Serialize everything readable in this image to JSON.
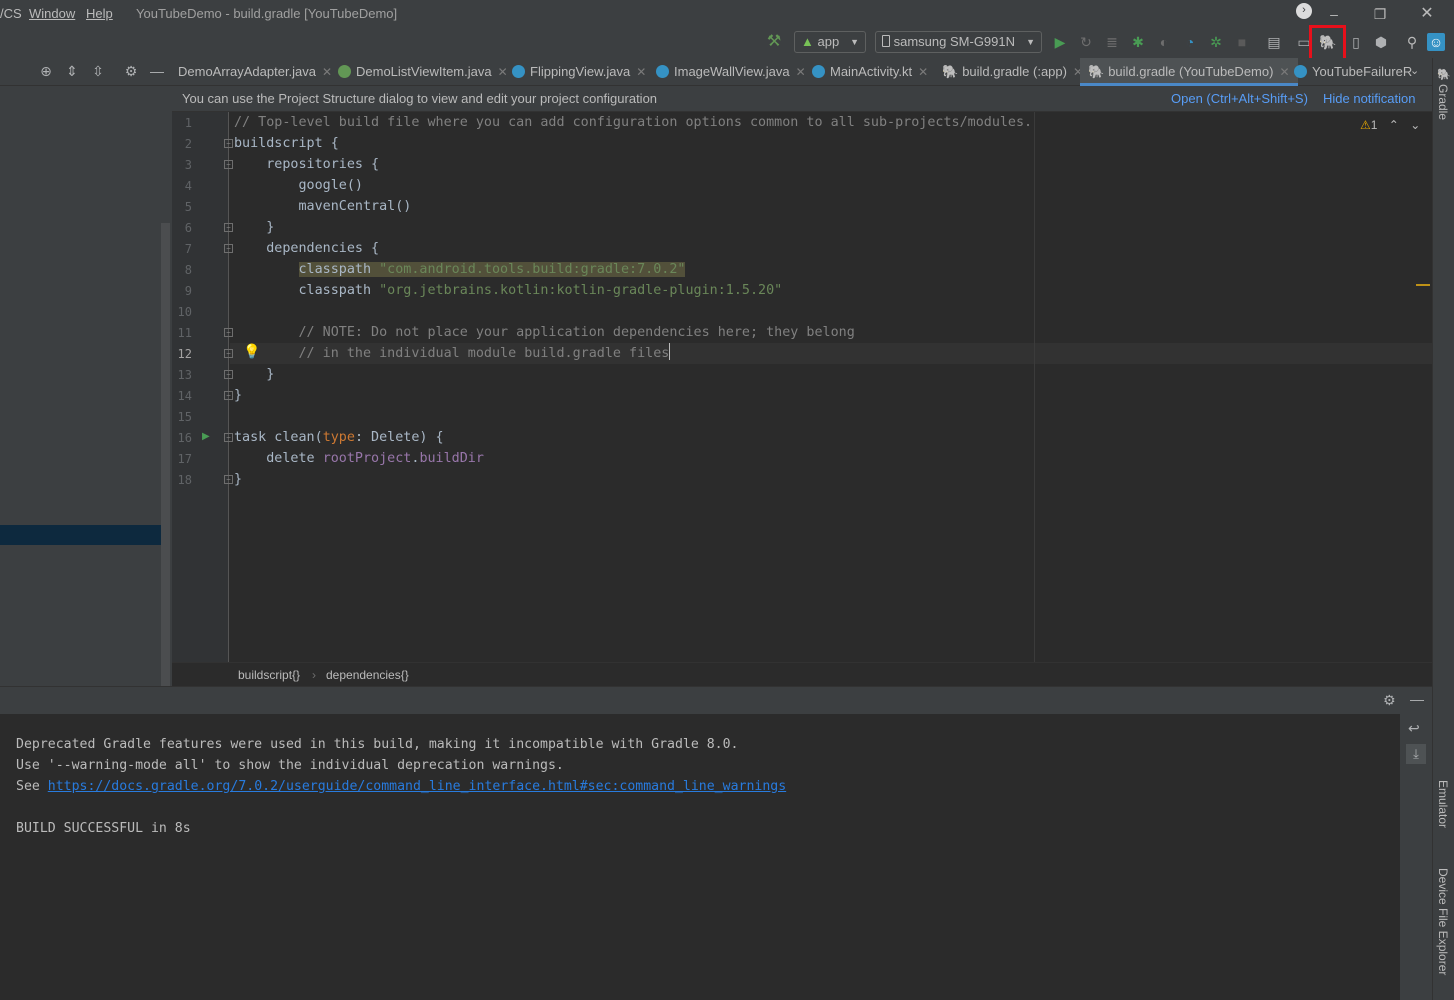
{
  "menu": {
    "vcs": "/CS",
    "window": "Window",
    "help": "Help"
  },
  "window_title": "YouTubeDemo - build.gradle [YouTubeDemo]",
  "toolbar": {
    "config_label": "app",
    "device_label": "samsung SM-G991N"
  },
  "tabs": [
    {
      "label": "DemoArrayAdapter.java",
      "icon_color": "#3c3f41"
    },
    {
      "label": "DemoListViewItem.java",
      "icon_color": "#629755"
    },
    {
      "label": "FlippingView.java",
      "icon_color": "#3592c4"
    },
    {
      "label": "ImageWallView.java",
      "icon_color": "#3592c4"
    },
    {
      "label": "MainActivity.kt",
      "icon_color": "#3592c4"
    },
    {
      "label": "build.gradle (:app)",
      "icon_color": "#8c8c8c"
    },
    {
      "label": "build.gradle (YouTubeDemo)",
      "icon_color": "#8c8c8c"
    },
    {
      "label": "YouTubeFailureR",
      "icon_color": "#3592c4"
    }
  ],
  "notification": {
    "message": "You can use the Project Structure dialog to view and edit your project configuration",
    "open_link": "Open (Ctrl+Alt+Shift+S)",
    "hide_link": "Hide notification"
  },
  "editor": {
    "warning_count": "1",
    "line_numbers": [
      "1",
      "2",
      "3",
      "4",
      "5",
      "6",
      "7",
      "8",
      "9",
      "10",
      "11",
      "12",
      "13",
      "14",
      "15",
      "16",
      "17",
      "18"
    ],
    "lines": {
      "l1": "// Top-level build file where you can add configuration options common to all sub-projects/modules.",
      "l2": "buildscript {",
      "l3": "    repositories {",
      "l4": "        google()",
      "l5": "        mavenCentral()",
      "l6": "    }",
      "l7": "    dependencies {",
      "l8_a": "        ",
      "l8_b": "classpath ",
      "l8_c": "\"com.android.tools.build:gradle:7.0.2\"",
      "l9_a": "        classpath ",
      "l9_b": "\"org.jetbrains.kotlin:kotlin-gradle-plugin:1.5.20\"",
      "l10": "",
      "l11": "        // NOTE: Do not place your application dependencies here; they belong",
      "l12": "        // in the individual module build.gradle files",
      "l13": "    }",
      "l14": "}",
      "l15": "",
      "l16_a": "task clean(",
      "l16_b": "type",
      "l16_c": ": Delete) {",
      "l17_a": "    delete ",
      "l17_b": "rootProject",
      "l17_c": ".",
      "l17_d": "buildDir",
      "l18": "}"
    }
  },
  "breadcrumb": {
    "item1": "buildscript{}",
    "item2": "dependencies{}"
  },
  "console": {
    "line1": "Deprecated Gradle features were used in this build, making it incompatible with Gradle 8.0.",
    "line2": "Use '--warning-mode all' to show the individual deprecation warnings.",
    "line3_prefix": "See ",
    "line3_link": "https://docs.gradle.org/7.0.2/userguide/command_line_interface.html#sec:command_line_warnings",
    "line4": "BUILD SUCCESSFUL in 8s"
  },
  "right_strip": {
    "gradle": "Gradle",
    "emulator": "Emulator",
    "device_file_explorer": "Device File Explorer"
  },
  "colors": {
    "highlight_box": "#e8101b",
    "link": "#589df6",
    "active_tab_underline": "#4a88c7"
  }
}
